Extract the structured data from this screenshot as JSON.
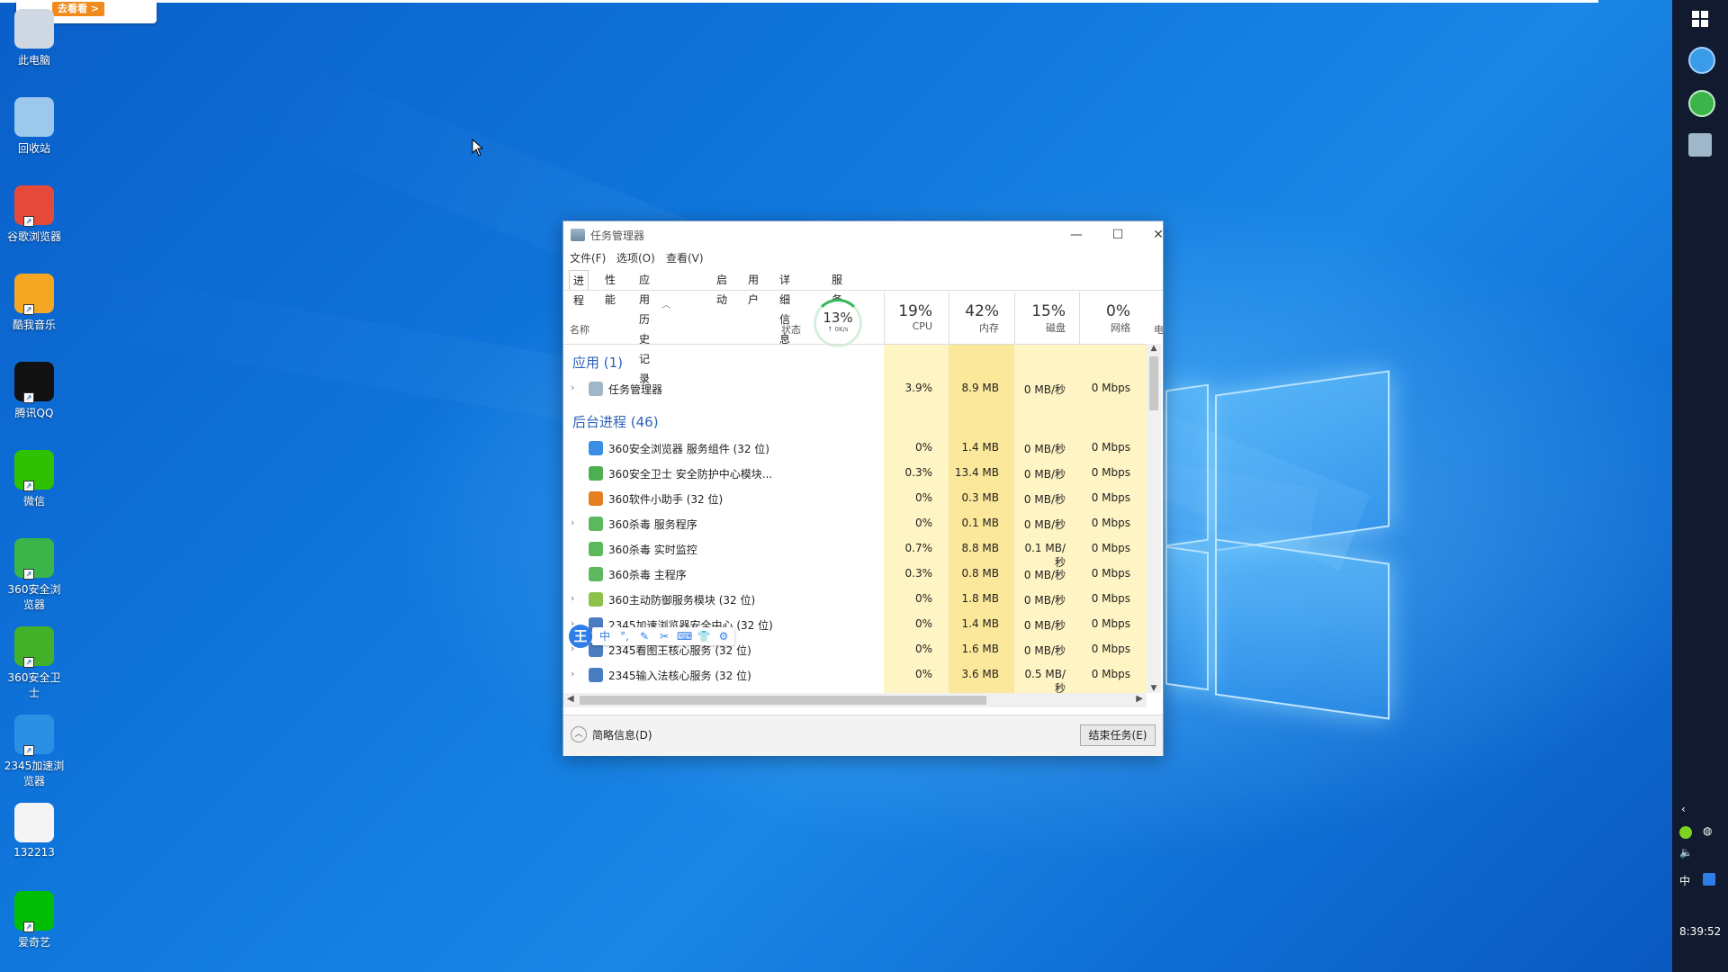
{
  "desktop": {
    "promo_tag": "去看看 >",
    "icons": [
      {
        "label": "此电脑",
        "icon": "computer-icon"
      },
      {
        "label": "回收站",
        "icon": "recycle-bin-icon"
      },
      {
        "label": "谷歌浏览器",
        "icon": "chrome-icon"
      },
      {
        "label": "酷我音乐",
        "icon": "kuwo-music-icon"
      },
      {
        "label": "腾讯QQ",
        "icon": "qq-icon"
      },
      {
        "label": "微信",
        "icon": "wechat-icon"
      },
      {
        "label": "360安全浏览器",
        "icon": "360-browser-icon"
      },
      {
        "label": "360安全卫士",
        "icon": "360-safe-icon"
      },
      {
        "label": "2345加速浏览器",
        "icon": "2345-browser-icon"
      },
      {
        "label": "132213",
        "icon": "docx-file-icon"
      },
      {
        "label": "爱奇艺",
        "icon": "iqiyi-icon"
      }
    ]
  },
  "taskbar": {
    "tray_lang": "中",
    "clock": "8:39:52"
  },
  "taskmgr": {
    "title": "任务管理器",
    "menu": [
      "文件(F)",
      "选项(O)",
      "查看(V)"
    ],
    "tabs": [
      "进程",
      "性能",
      "应用历史记录",
      "启动",
      "用户",
      "详细信息",
      "服务"
    ],
    "columns": {
      "name": "名称",
      "status": "状态",
      "gpu_gauge": "13%",
      "gpu_gauge_sub": "↑ 0K/s",
      "cpu_pct": "19%",
      "cpu": "CPU",
      "mem_pct": "42%",
      "mem": "内存",
      "disk_pct": "15%",
      "disk": "磁盘",
      "net_pct": "0%",
      "net": "网络",
      "power": "电"
    },
    "apps_group": "应用 (1)",
    "apps": [
      {
        "name": "任务管理器",
        "cpu": "3.9%",
        "mem": "8.9 MB",
        "disk": "0 MB/秒",
        "net": "0 Mbps",
        "expand": true
      }
    ],
    "bg_group": "后台进程 (46)",
    "bg": [
      {
        "name": "360安全浏览器 服务组件 (32 位)",
        "cpu": "0%",
        "mem": "1.4 MB",
        "disk": "0 MB/秒",
        "net": "0 Mbps",
        "expand": false,
        "color": "#3a8ee6"
      },
      {
        "name": "360安全卫士 安全防护中心模块...",
        "cpu": "0.3%",
        "mem": "13.4 MB",
        "disk": "0 MB/秒",
        "net": "0 Mbps",
        "expand": false,
        "color": "#4caf50"
      },
      {
        "name": "360软件小助手 (32 位)",
        "cpu": "0%",
        "mem": "0.3 MB",
        "disk": "0 MB/秒",
        "net": "0 Mbps",
        "expand": false,
        "color": "#e67e22"
      },
      {
        "name": "360杀毒 服务程序",
        "cpu": "0%",
        "mem": "0.1 MB",
        "disk": "0 MB/秒",
        "net": "0 Mbps",
        "expand": true,
        "color": "#5cb85c"
      },
      {
        "name": "360杀毒 实时监控",
        "cpu": "0.7%",
        "mem": "8.8 MB",
        "disk": "0.1 MB/秒",
        "net": "0 Mbps",
        "expand": false,
        "color": "#5cb85c"
      },
      {
        "name": "360杀毒 主程序",
        "cpu": "0.3%",
        "mem": "0.8 MB",
        "disk": "0 MB/秒",
        "net": "0 Mbps",
        "expand": false,
        "color": "#5cb85c"
      },
      {
        "name": "360主动防御服务模块 (32 位)",
        "cpu": "0%",
        "mem": "1.8 MB",
        "disk": "0 MB/秒",
        "net": "0 Mbps",
        "expand": true,
        "color": "#8bc34a"
      },
      {
        "name": "2345加速浏览器安全中心 (32 位)",
        "cpu": "0%",
        "mem": "1.4 MB",
        "disk": "0 MB/秒",
        "net": "0 Mbps",
        "expand": true,
        "color": "#4a7cc0"
      },
      {
        "name": "2345看图王核心服务 (32 位)",
        "cpu": "0%",
        "mem": "1.6 MB",
        "disk": "0 MB/秒",
        "net": "0 Mbps",
        "expand": true,
        "color": "#4a7cc0"
      },
      {
        "name": "2345输入法核心服务 (32 位)",
        "cpu": "0%",
        "mem": "3.6 MB",
        "disk": "0.5 MB/秒",
        "net": "0 Mbps",
        "expand": true,
        "color": "#4a7cc0"
      }
    ],
    "footer_toggle": "简略信息(D)",
    "end_task": "结束任务(E)"
  },
  "ime": {
    "logo": "王",
    "lang": "中"
  }
}
